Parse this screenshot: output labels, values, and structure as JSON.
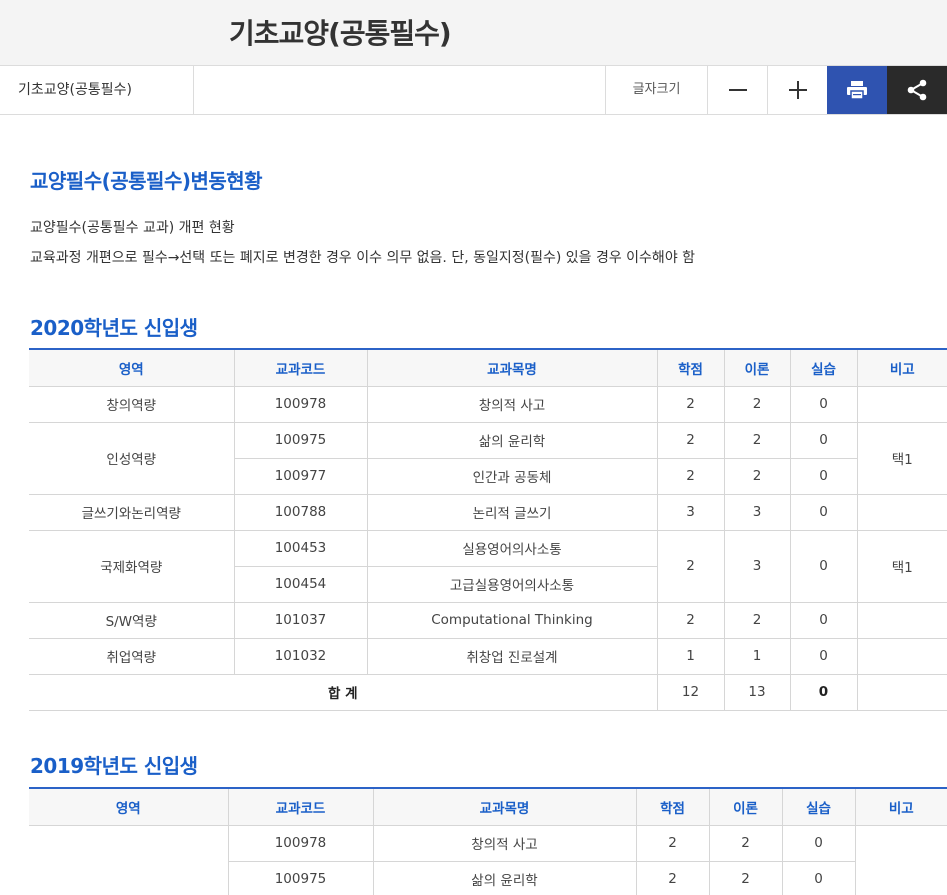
{
  "page": {
    "title": "기초교양(공통필수)"
  },
  "toolbar": {
    "breadcrumb": "기초교양(공통필수)",
    "fontsize_label": "글자크기"
  },
  "section1": {
    "heading": "교양필수(공통필수)변동현황",
    "line1": "교양필수(공통필수 교과) 개편 현황",
    "line2": "교육과정 개편으로 필수→선택 또는 폐지로 변경한 경우 이수 의무 없음. 단, 동일지정(필수) 있을 경우 이수해야 함"
  },
  "table_headers": [
    "영역",
    "교과코드",
    "교과목명",
    "학점",
    "이론",
    "실습",
    "비고"
  ],
  "section2020": {
    "heading": "2020학년도 신입생",
    "rows": [
      {
        "area": "창의역량",
        "code": "100978",
        "name": "창의적 사고",
        "credit": "2",
        "theory": "2",
        "practice": "0",
        "note": ""
      },
      {
        "area": "인성역량",
        "code": "100975",
        "name": "삶의 윤리학",
        "credit": "2",
        "theory": "2",
        "practice": "0",
        "note": "택1"
      },
      {
        "code": "100977",
        "name": "인간과 공동체",
        "credit": "2",
        "theory": "2",
        "practice": "0"
      },
      {
        "area": "글쓰기와논리역량",
        "code": "100788",
        "name": "논리적 글쓰기",
        "credit": "3",
        "theory": "3",
        "practice": "0",
        "note": ""
      },
      {
        "area": "국제화역량",
        "code": "100453",
        "name": "실용영어의사소통",
        "credit": "2",
        "theory": "3",
        "practice": "0",
        "note": "택1"
      },
      {
        "code": "100454",
        "name": "고급실용영어의사소통"
      },
      {
        "area": "S/W역량",
        "code": "101037",
        "name": "Computational Thinking",
        "credit": "2",
        "theory": "2",
        "practice": "0",
        "note": ""
      },
      {
        "area": "취업역량",
        "code": "101032",
        "name": "취창업 진로설계",
        "credit": "1",
        "theory": "1",
        "practice": "0",
        "note": ""
      }
    ],
    "total": {
      "label": "합 계",
      "credit": "12",
      "theory": "13",
      "practice": "0"
    }
  },
  "section2019": {
    "heading": "2019학년도 신입생",
    "rows": [
      {
        "code": "100978",
        "name": "창의적 사고",
        "credit": "2",
        "theory": "2",
        "practice": "0"
      },
      {
        "code": "100975",
        "name": "삶의 윤리학",
        "credit": "2",
        "theory": "2",
        "practice": "0"
      }
    ]
  }
}
